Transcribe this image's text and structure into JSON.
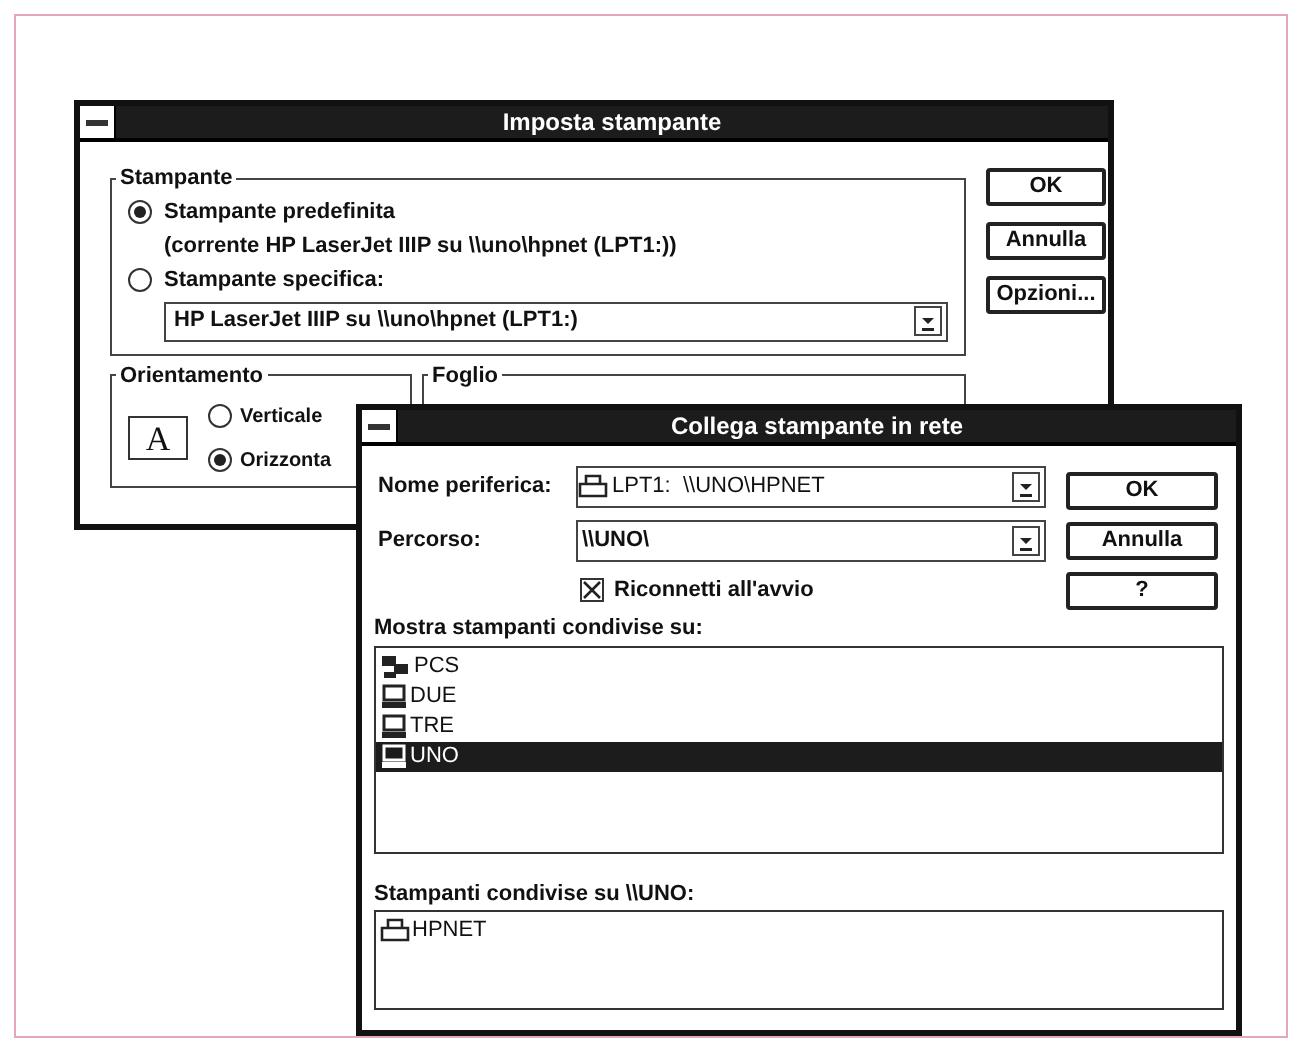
{
  "back_window": {
    "title": "Imposta stampante",
    "printer_group": {
      "label": "Stampante",
      "options": [
        {
          "label": "Stampante predefinita",
          "selected": true,
          "detail": "(corrente HP LaserJet IIIP su \\\\uno\\hpnet (LPT1:))"
        },
        {
          "label": "Stampante specifica:",
          "selected": false
        }
      ],
      "combo": {
        "value": "HP LaserJet IIIP su \\\\uno\\hpnet (LPT1:)"
      }
    },
    "buttons": [
      "OK",
      "Annulla",
      "Opzioni..."
    ],
    "orientation_group": {
      "label": "Orientamento",
      "icon_letter": "A",
      "options": [
        {
          "label": "Verticale",
          "selected": false
        },
        {
          "label": "Orizzonta",
          "selected": true
        }
      ]
    },
    "paper_group": {
      "label": "Foglio"
    }
  },
  "front_window": {
    "title": "Collega stampante in rete",
    "fields": [
      {
        "label": "Nome periferica:",
        "value": "LPT1:  \\\\UNO\\HPNET",
        "kind": "printer"
      },
      {
        "label": "Percorso:",
        "value": "\\\\UNO\\",
        "kind": "path"
      }
    ],
    "checkbox": {
      "label": "Riconnetti all'avvio",
      "checked": true
    },
    "buttons": [
      "OK",
      "Annulla",
      "?"
    ],
    "computers_label": "Mostra stampanti condivise su:",
    "computers": [
      {
        "name": "PCS",
        "kind": "group",
        "selected": false
      },
      {
        "name": "DUE",
        "kind": "computer",
        "selected": false
      },
      {
        "name": "TRE",
        "kind": "computer",
        "selected": false
      },
      {
        "name": "UNO",
        "kind": "computer",
        "selected": true
      }
    ],
    "printers_label": "Stampanti condivise su \\\\UNO:",
    "printers": [
      {
        "name": "HPNET",
        "selected": false
      }
    ]
  }
}
